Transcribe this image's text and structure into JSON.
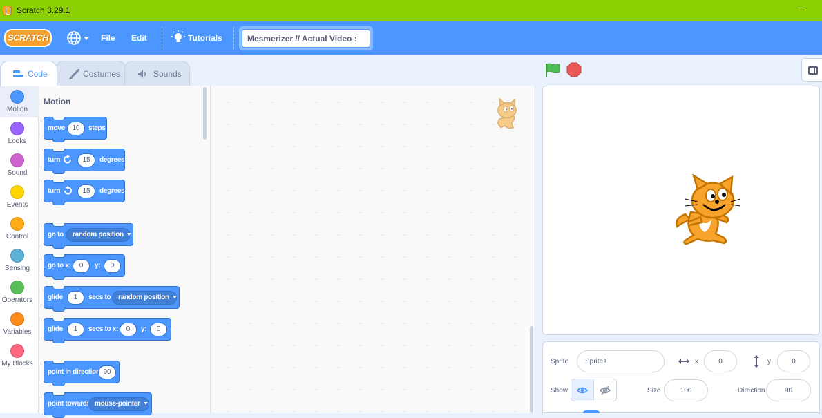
{
  "window": {
    "title": "Scratch 3.29.1"
  },
  "menubar": {
    "logo": "SCRATCH",
    "file": "File",
    "edit": "Edit",
    "tutorials": "Tutorials",
    "project_title": "Mesmerizer // Actual Video :"
  },
  "tabs": [
    {
      "label": "Code",
      "active": true
    },
    {
      "label": "Costumes",
      "active": false
    },
    {
      "label": "Sounds",
      "active": false
    }
  ],
  "categories": [
    {
      "label": "Motion",
      "color": "#4c97ff"
    },
    {
      "label": "Looks",
      "color": "#9966ff"
    },
    {
      "label": "Sound",
      "color": "#cf63cf"
    },
    {
      "label": "Events",
      "color": "#ffd500"
    },
    {
      "label": "Control",
      "color": "#ffab19"
    },
    {
      "label": "Sensing",
      "color": "#5cb1d6"
    },
    {
      "label": "Operators",
      "color": "#59c059"
    },
    {
      "label": "Variables",
      "color": "#ff8c1a"
    },
    {
      "label": "My Blocks",
      "color": "#ff6680"
    }
  ],
  "palette": {
    "section_title": "Motion",
    "blocks": {
      "move": {
        "t1": "move",
        "v1": "10",
        "t2": "steps"
      },
      "turn_cw": {
        "t1": "turn",
        "v1": "15",
        "t2": "degrees",
        "icon": "rotate-right-icon"
      },
      "turn_ccw": {
        "t1": "turn",
        "v1": "15",
        "t2": "degrees",
        "icon": "rotate-left-icon"
      },
      "goto": {
        "t1": "go to",
        "menu": "random position"
      },
      "goto_xy": {
        "t1": "go to x:",
        "v1": "0",
        "t2": "y:",
        "v2": "0"
      },
      "glide": {
        "t1": "glide",
        "v1": "1",
        "t2": "secs to",
        "menu": "random position"
      },
      "glide_xy": {
        "t1": "glide",
        "v1": "1",
        "t2": "secs to x:",
        "v2": "0",
        "t3": "y:",
        "v3": "0"
      },
      "point_dir": {
        "t1": "point in direction",
        "v1": "90"
      },
      "point_towards": {
        "t1": "point towards",
        "menu": "mouse-pointer"
      }
    }
  },
  "sprite_info": {
    "sprite_label": "Sprite",
    "sprite_name": "Sprite1",
    "x_label": "x",
    "x_value": "0",
    "y_label": "y",
    "y_value": "0",
    "show_label": "Show",
    "size_label": "Size",
    "size_value": "100",
    "direction_label": "Direction",
    "direction_value": "90"
  },
  "colors": {
    "titlebar": "#8bd000",
    "menubar": "#4c97ff",
    "motion_block": "#4c97ff",
    "green_flag": "#4cbf56",
    "stop": "#ec5959"
  }
}
